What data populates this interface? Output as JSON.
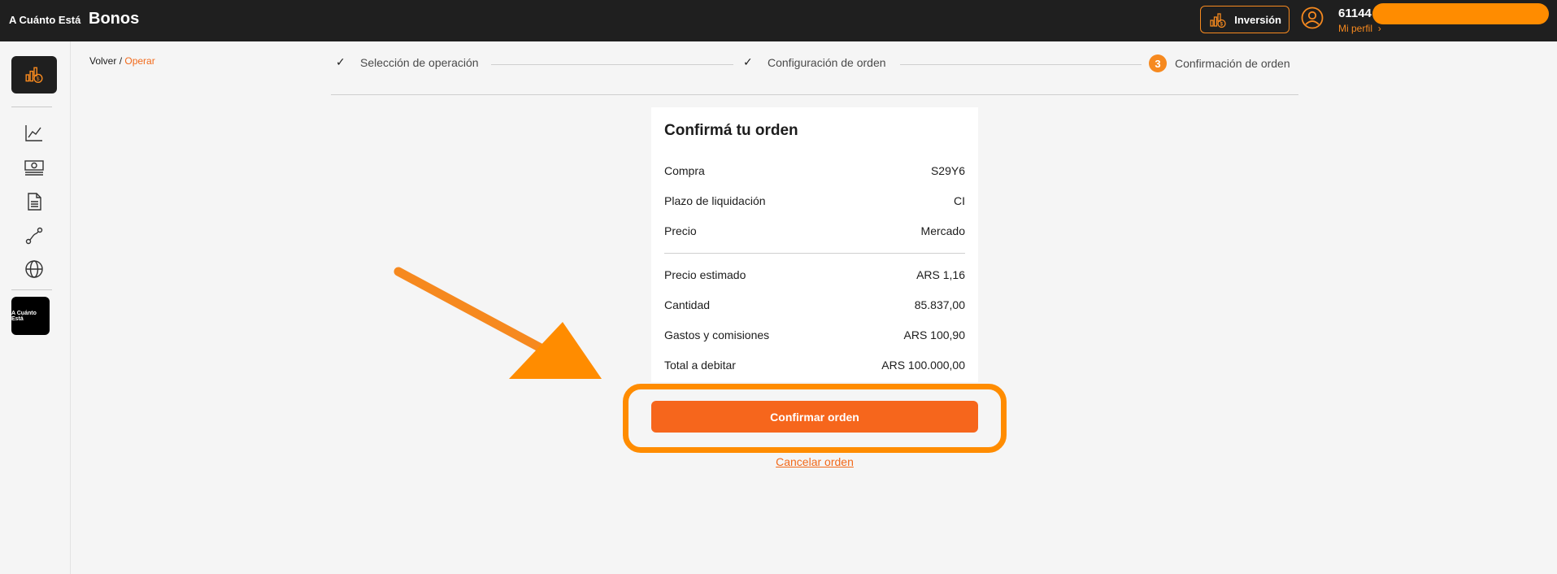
{
  "header": {
    "brand": "A Cuánto Está",
    "page_title": "Bonos",
    "invest_label": "Inversión",
    "user_id": "61144",
    "profile_link": "Mi perfil"
  },
  "sidebar": {
    "logo_text": "A Cuánto Está"
  },
  "breadcrumb": {
    "back": "Volver",
    "separator": " / ",
    "current": "Operar"
  },
  "stepper": {
    "steps": [
      {
        "label": "Selección de operación",
        "state": "done"
      },
      {
        "label": "Configuración de orden",
        "state": "done"
      },
      {
        "label": "Confirmación de orden",
        "state": "current",
        "number": "3"
      }
    ]
  },
  "card": {
    "title": "Confirmá tu orden",
    "rows": [
      {
        "label": "Compra",
        "value": "S29Y6"
      },
      {
        "label": "Plazo de liquidación",
        "value": "CI"
      },
      {
        "label": "Precio",
        "value": "Mercado"
      },
      {
        "label": "Precio estimado",
        "value": "ARS 1,16"
      },
      {
        "label": "Cantidad",
        "value": "85.837,00"
      },
      {
        "label": "Gastos y comisiones",
        "value": "ARS 100,90"
      },
      {
        "label": "Total a debitar",
        "value": "ARS 100.000,00"
      }
    ]
  },
  "actions": {
    "confirm_label": "Confirmar orden",
    "cancel_label": "Cancelar orden"
  },
  "colors": {
    "accent": "#f6891f",
    "button": "#f6661c",
    "highlight": "#ff8c00",
    "topbar": "#1f1f1f"
  }
}
